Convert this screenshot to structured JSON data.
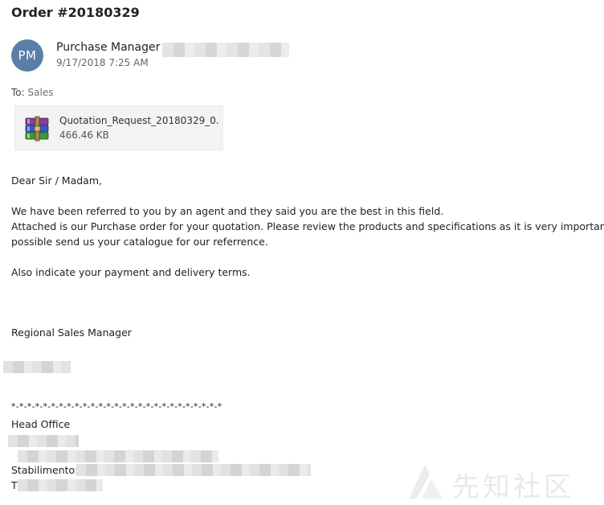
{
  "email": {
    "subject": "Order #20180329",
    "sender": {
      "initials": "PM",
      "name": "Purchase Manager",
      "datetime": "9/17/2018 7:25 AM",
      "avatar_color": "#5a7fa6"
    },
    "to_label": "To:",
    "to_value": "Sales",
    "attachment": {
      "name": "Quotation_Request_20180329_0...",
      "size": "466.46 KB",
      "icon": "winrar-archive-icon"
    },
    "body": {
      "greeting": "Dear Sir / Madam,",
      "line1": "We have been referred to you by an agent and they said you are the best in this field.",
      "line2": "Attached is our Purchase order for your quotation. Please review the products and specifications as it is very important to u",
      "line3": "possible send us your catalogue for our referrence.",
      "line4": "Also indicate your payment and delivery terms.",
      "signature_title": "Regional Sales Manager",
      "separator": "*-*-*-*-*-*-*-*-*-*-*-*-*-*-*-*-*-*-*-*-*-*-*-*-*-*-*",
      "head_office": "Head Office",
      "stabilimento_label": "Stabilimento:",
      "tel_prefix": "T"
    }
  },
  "watermark": {
    "text": "先知社区"
  }
}
